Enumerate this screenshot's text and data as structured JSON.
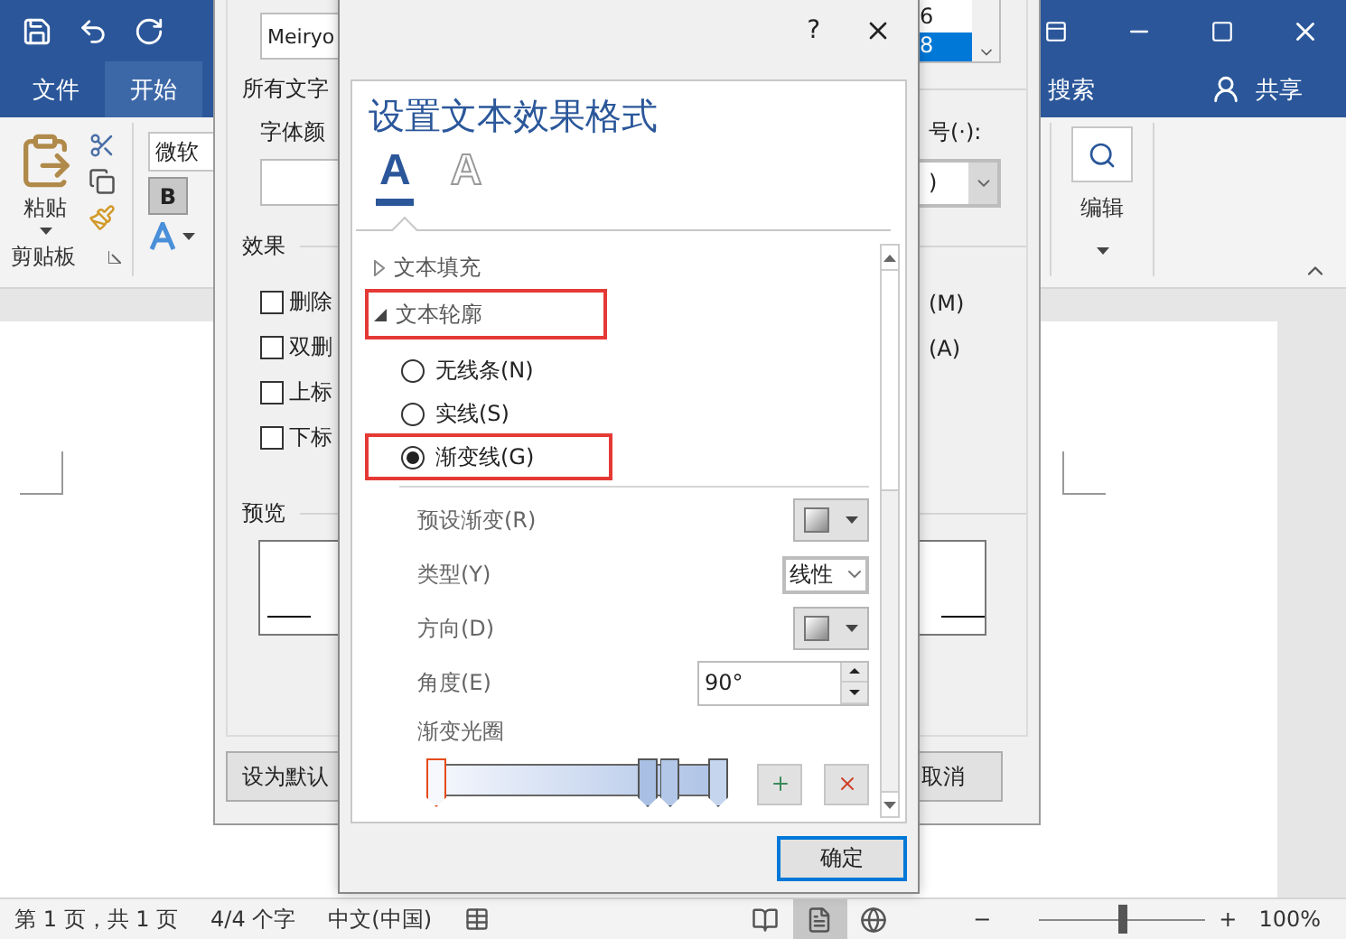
{
  "word": {
    "tabs": [
      {
        "label": "文件",
        "selected": false
      },
      {
        "label": "开始",
        "selected": true
      }
    ],
    "search_hint": "搜索",
    "share": "共享",
    "ribbon": {
      "font_box": "微软",
      "bold": "B",
      "paste": "粘贴",
      "clipboard_group": "剪贴板",
      "editing": "编辑"
    },
    "status_bar": {
      "page": "第 1 页，共 1 页",
      "words": "4/4 个字",
      "language": "中文(中国)",
      "views": [
        {
          "kind": "read",
          "selected": false
        },
        {
          "kind": "print",
          "selected": true
        },
        {
          "kind": "web",
          "selected": false
        }
      ],
      "zoom_minus": "−",
      "zoom_slider": {
        "level": 0.5
      },
      "zoom_plus": "+",
      "zoom": "100%"
    }
  },
  "font_dialog": {
    "font_value": "Meiryo",
    "sizes": [
      {
        "label": "6",
        "selected": false
      },
      {
        "label": "8",
        "selected": true
      }
    ],
    "all_text": "所有文字",
    "font_color_label": "字体颜",
    "emphasis_label": "号(·):",
    "emphasis_value": ")",
    "effects_label": "效果",
    "effects": [
      {
        "label": "删除",
        "checked": false,
        "right": "(M)"
      },
      {
        "label": "双删",
        "checked": false,
        "right": "(A)"
      },
      {
        "label": "上标",
        "checked": false
      },
      {
        "label": "下标",
        "checked": false
      }
    ],
    "preview_label": "预览",
    "default_button": "设为默认",
    "cancel_button": "取消"
  },
  "format_dialog": {
    "help": "?",
    "title": "设置文本效果格式",
    "icon_tabs": [
      {
        "kind": "fill",
        "glyph": "A",
        "selected": true
      },
      {
        "kind": "outline",
        "glyph": "A",
        "selected": false
      }
    ],
    "sections": [
      {
        "label": "文本填充",
        "expanded": false,
        "highlighted": false
      },
      {
        "label": "文本轮廓",
        "expanded": true,
        "highlighted": true
      }
    ],
    "line_options": [
      {
        "label": "无线条(N)",
        "selected": false,
        "highlighted": false
      },
      {
        "label": "实线(S)",
        "selected": false,
        "highlighted": false
      },
      {
        "label": "渐变线(G)",
        "selected": true,
        "highlighted": true
      }
    ],
    "rows": [
      {
        "kind": "swatch",
        "label": "预设渐变(R)"
      },
      {
        "kind": "select",
        "label": "类型(Y)",
        "value": "线性"
      },
      {
        "kind": "swatch",
        "label": "方向(D)"
      },
      {
        "kind": "spin",
        "label": "角度(E)",
        "value": "90°"
      }
    ],
    "stops_label": "渐变光圈",
    "gradient_stops": [
      {
        "level": 0,
        "selected": true
      },
      {
        "level": 0.75,
        "selected": false
      },
      {
        "level": 0.83,
        "selected": false
      },
      {
        "level": 1,
        "selected": false
      }
    ],
    "ok_button": "确定"
  }
}
